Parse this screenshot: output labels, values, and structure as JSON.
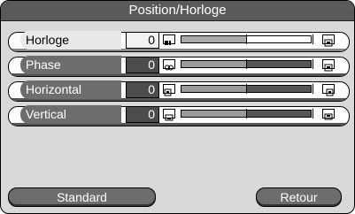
{
  "title": "Position/Horloge",
  "rows": [
    {
      "label": "Horloge",
      "value": "0",
      "level": 0.5,
      "min_icon": "horloge-min-icon",
      "max_icon": "horloge-max-icon",
      "active": true
    },
    {
      "label": "Phase",
      "value": "0",
      "level": 0.5,
      "min_icon": "phase-min-icon",
      "max_icon": "phase-max-icon",
      "active": false
    },
    {
      "label": "Horizontal",
      "value": "0",
      "level": 0.5,
      "min_icon": "horizontal-left-icon",
      "max_icon": "horizontal-right-icon",
      "active": false
    },
    {
      "label": "Vertical",
      "value": "0",
      "level": 0.5,
      "min_icon": "vertical-down-icon",
      "max_icon": "vertical-up-icon",
      "active": false
    }
  ],
  "buttons": {
    "standard": "Standard",
    "retour": "Retour"
  }
}
